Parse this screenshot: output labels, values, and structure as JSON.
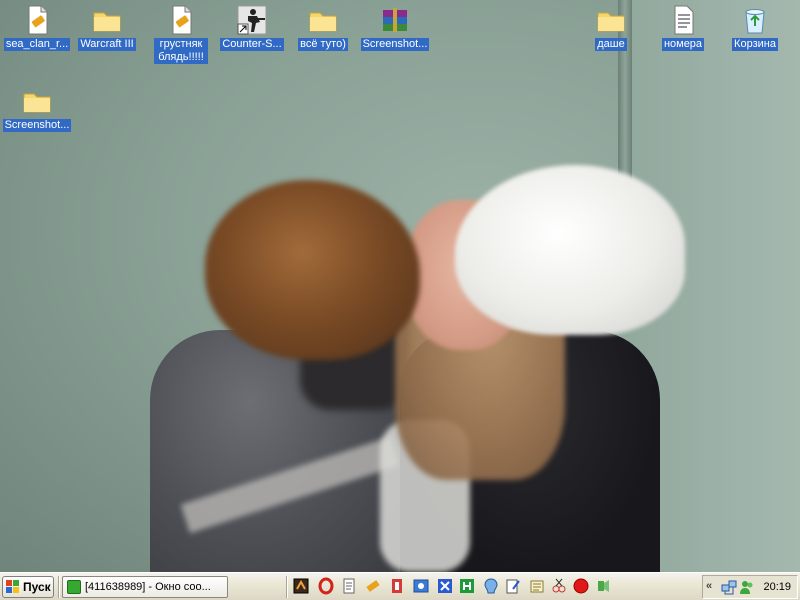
{
  "desktop": {
    "icons": [
      {
        "label": "sea_clan_r...",
        "icon": "winamp-skin-file-icon"
      },
      {
        "label": "Warcraft III",
        "icon": "folder-icon"
      },
      {
        "label": "грустняк блядь!!!!!",
        "icon": "winamp-skin-file-icon"
      },
      {
        "label": "Counter-S...",
        "icon": "counter-strike-shortcut-icon"
      },
      {
        "label": "всё туто)",
        "icon": "folder-icon"
      },
      {
        "label": "Screenshot...",
        "icon": "winrar-archive-icon"
      },
      {
        "label": "даше",
        "icon": "folder-icon"
      },
      {
        "label": "номера",
        "icon": "text-document-icon"
      },
      {
        "label": "Корзина",
        "icon": "recycle-bin-icon"
      },
      {
        "label": "Screenshot...",
        "icon": "folder-icon"
      }
    ]
  },
  "taskbar": {
    "start_label": "Пуск",
    "window_button_label": "[411638989] - Окно соо...",
    "quick_launch": [
      "winamp-icon",
      "opera-icon",
      "notepad-icon",
      "tools-icon",
      "bookmark-icon",
      "browser-icon",
      "task-icon",
      "sync-icon",
      "green-app-icon",
      "headset-icon",
      "edit-icon",
      "notes-icon",
      "tool-icon",
      "record-icon",
      "audio-icon"
    ],
    "tray": {
      "chevron": "«",
      "icons": [
        "network-icon",
        "users-online-icon"
      ],
      "clock": "20:19"
    }
  },
  "colors": {
    "selection": "#316ac5",
    "taskbar": "#ece9d8",
    "folder": "#f5d76e"
  }
}
